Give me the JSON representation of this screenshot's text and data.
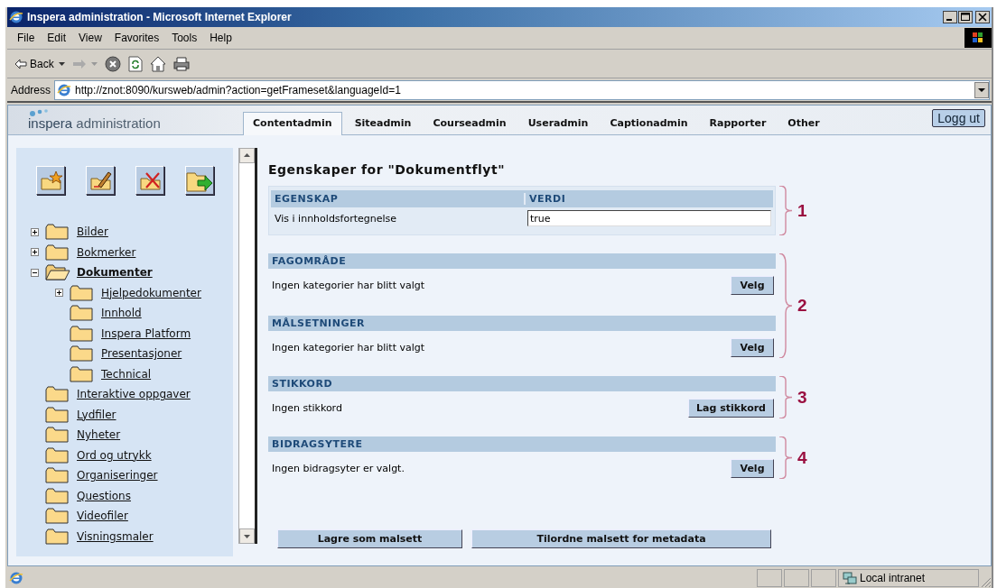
{
  "window": {
    "title": "Inspera administration - Microsoft Internet Explorer"
  },
  "menu": [
    "File",
    "Edit",
    "View",
    "Favorites",
    "Tools",
    "Help"
  ],
  "toolbar": {
    "back_label": "Back"
  },
  "address": {
    "label": "Address",
    "url": "http://znot:8090/kursweb/admin?action=getFrameset&languageId=1"
  },
  "app": {
    "logo": "inspera",
    "logo_suffix": "administration",
    "tabs": [
      {
        "label": "Contentadmin",
        "selected": true
      },
      {
        "label": "Siteadmin",
        "selected": false
      },
      {
        "label": "Courseadmin",
        "selected": false
      },
      {
        "label": "Useradmin",
        "selected": false
      },
      {
        "label": "Captionadmin",
        "selected": false
      },
      {
        "label": "Rapporter",
        "selected": false
      },
      {
        "label": "Other",
        "selected": false
      }
    ],
    "logout": "Logg ut"
  },
  "sidebar": {
    "tools": [
      {
        "kind": "new"
      },
      {
        "kind": "edit"
      },
      {
        "kind": "delete"
      },
      {
        "kind": "move"
      }
    ],
    "tree": [
      {
        "label": "Bilder",
        "kind": "branch",
        "expanded": false,
        "selected": false
      },
      {
        "label": "Bokmerker",
        "kind": "branch",
        "expanded": false,
        "selected": false
      },
      {
        "label": "Dokumenter",
        "kind": "branch",
        "expanded": true,
        "selected": true,
        "children": [
          {
            "label": "Hjelpedokumenter",
            "kind": "branch",
            "expanded": false,
            "selected": false
          },
          {
            "label": "Innhold",
            "kind": "leaf",
            "selected": false
          },
          {
            "label": "Inspera Platform",
            "kind": "leaf",
            "selected": false
          },
          {
            "label": "Presentasjoner",
            "kind": "leaf",
            "selected": false
          },
          {
            "label": "Technical",
            "kind": "leaf",
            "selected": false
          }
        ]
      },
      {
        "label": "Interaktive oppgaver",
        "kind": "leaf",
        "selected": false
      },
      {
        "label": "Lydfiler",
        "kind": "leaf",
        "selected": false
      },
      {
        "label": "Nyheter",
        "kind": "leaf",
        "selected": false
      },
      {
        "label": "Ord og utrykk",
        "kind": "leaf",
        "selected": false
      },
      {
        "label": "Organiseringer",
        "kind": "leaf",
        "selected": false
      },
      {
        "label": "Questions",
        "kind": "leaf",
        "selected": false
      },
      {
        "label": "Videofiler",
        "kind": "leaf",
        "selected": false
      },
      {
        "label": "Visningsmaler",
        "kind": "leaf",
        "selected": false
      }
    ]
  },
  "main": {
    "title": "Egenskaper for \"Dokumentflyt\"",
    "groups": [
      {
        "marker": "1",
        "sections": [
          {
            "kind": "properties",
            "columns": [
              "EGENSKAP",
              "VERDI"
            ],
            "rows": [
              {
                "property": "Vis i innholdsfortegnelse",
                "value": "true"
              }
            ]
          }
        ]
      },
      {
        "marker": "2",
        "sections": [
          {
            "kind": "picker",
            "heading": "FAGOMRÅDE",
            "text": "Ingen kategorier har blitt valgt",
            "button": "Velg"
          },
          {
            "kind": "picker",
            "heading": "MÅLSETNINGER",
            "text": "Ingen kategorier har blitt valgt",
            "button": "Velg"
          }
        ]
      },
      {
        "marker": "3",
        "sections": [
          {
            "kind": "picker",
            "heading": "STIKKORD",
            "text": "Ingen stikkord",
            "button": "Lag stikkord"
          }
        ]
      },
      {
        "marker": "4",
        "sections": [
          {
            "kind": "picker",
            "heading": "BIDRAGSYTERE",
            "text": "Ingen bidragsyter er valgt.",
            "button": "Velg"
          }
        ]
      }
    ],
    "actions": [
      "Lagre som malsett",
      "Tilordne malsett for metadata"
    ]
  },
  "status_bar": {
    "zone": "Local intranet"
  }
}
